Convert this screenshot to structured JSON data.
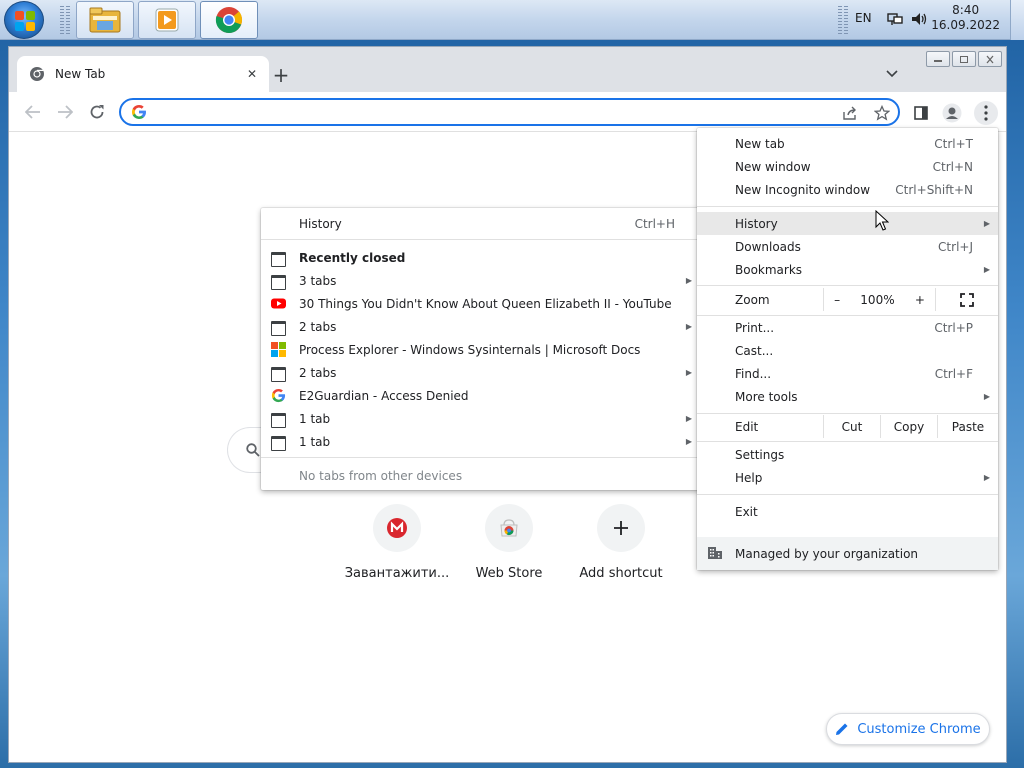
{
  "taskbar": {
    "language": "EN",
    "time": "8:40",
    "date": "16.09.2022"
  },
  "tab": {
    "title": "New Tab",
    "close_glyph": "✕",
    "new_tab_glyph": "+",
    "search_glyph": "⌄"
  },
  "omnibox": {
    "value": "",
    "placeholder": ""
  },
  "main_menu": {
    "items": [
      {
        "label": "New tab",
        "shortcut": "Ctrl+T"
      },
      {
        "label": "New window",
        "shortcut": "Ctrl+N"
      },
      {
        "label": "New Incognito window",
        "shortcut": "Ctrl+Shift+N"
      },
      {
        "label": "History",
        "shortcut": ""
      },
      {
        "label": "Downloads",
        "shortcut": "Ctrl+J"
      },
      {
        "label": "Bookmarks",
        "shortcut": ""
      }
    ],
    "zoom": {
      "label": "Zoom",
      "minus": "–",
      "value": "100%",
      "plus": "+"
    },
    "items2": [
      {
        "label": "Print...",
        "shortcut": "Ctrl+P"
      },
      {
        "label": "Cast...",
        "shortcut": ""
      },
      {
        "label": "Find...",
        "shortcut": "Ctrl+F"
      },
      {
        "label": "More tools",
        "shortcut": ""
      }
    ],
    "edit": {
      "label": "Edit",
      "cut": "Cut",
      "copy": "Copy",
      "paste": "Paste"
    },
    "items3": [
      {
        "label": "Settings"
      },
      {
        "label": "Help"
      },
      {
        "label": "Exit"
      }
    ],
    "managed": "Managed by your organization"
  },
  "history_menu": {
    "header": {
      "label": "History",
      "shortcut": "Ctrl+H"
    },
    "recently_closed": "Recently closed",
    "entries": [
      {
        "label": "3 tabs",
        "icon": "tab-group-icon"
      },
      {
        "label": "30 Things You Didn't Know About Queen Elizabeth II - YouTube",
        "icon": "youtube-icon"
      },
      {
        "label": "2 tabs",
        "icon": "tab-group-icon"
      },
      {
        "label": "Process Explorer - Windows Sysinternals | Microsoft Docs",
        "icon": "microsoft-icon"
      },
      {
        "label": "2 tabs",
        "icon": "tab-group-icon"
      },
      {
        "label": "E2Guardian - Access Denied",
        "icon": "google-icon"
      },
      {
        "label": "1 tab",
        "icon": "tab-group-icon"
      },
      {
        "label": "1 tab",
        "icon": "tab-group-icon"
      }
    ],
    "footer": "No tabs from other devices"
  },
  "shortcuts": [
    {
      "label": "Завантажити...",
      "icon": "mega-icon"
    },
    {
      "label": "Web Store",
      "icon": "web-store-icon"
    },
    {
      "label": "Add shortcut",
      "icon": "plus-icon"
    }
  ],
  "customize": {
    "label": "Customize Chrome"
  },
  "colors": {
    "accent": "#1a73e8",
    "youtube": "#ff0000",
    "mega": "#d9272e"
  }
}
